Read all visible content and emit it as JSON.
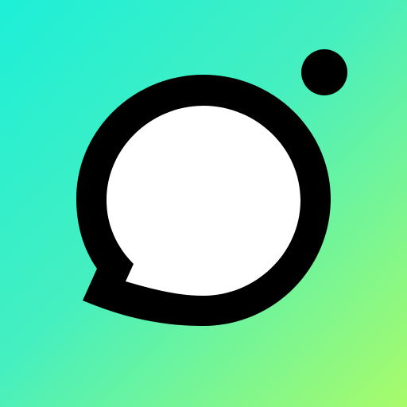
{
  "icon": {
    "name": "chat-bubble-camera-app-icon",
    "glyph": "speech-bubble-lens-icon",
    "colors": {
      "gradient_start": "#1DEFD8",
      "gradient_mid": "#45EFC0",
      "gradient_end": "#A8FB6A",
      "ring": "#000000",
      "inner_fill": "#FFFFFF",
      "dot": "#000000"
    }
  }
}
